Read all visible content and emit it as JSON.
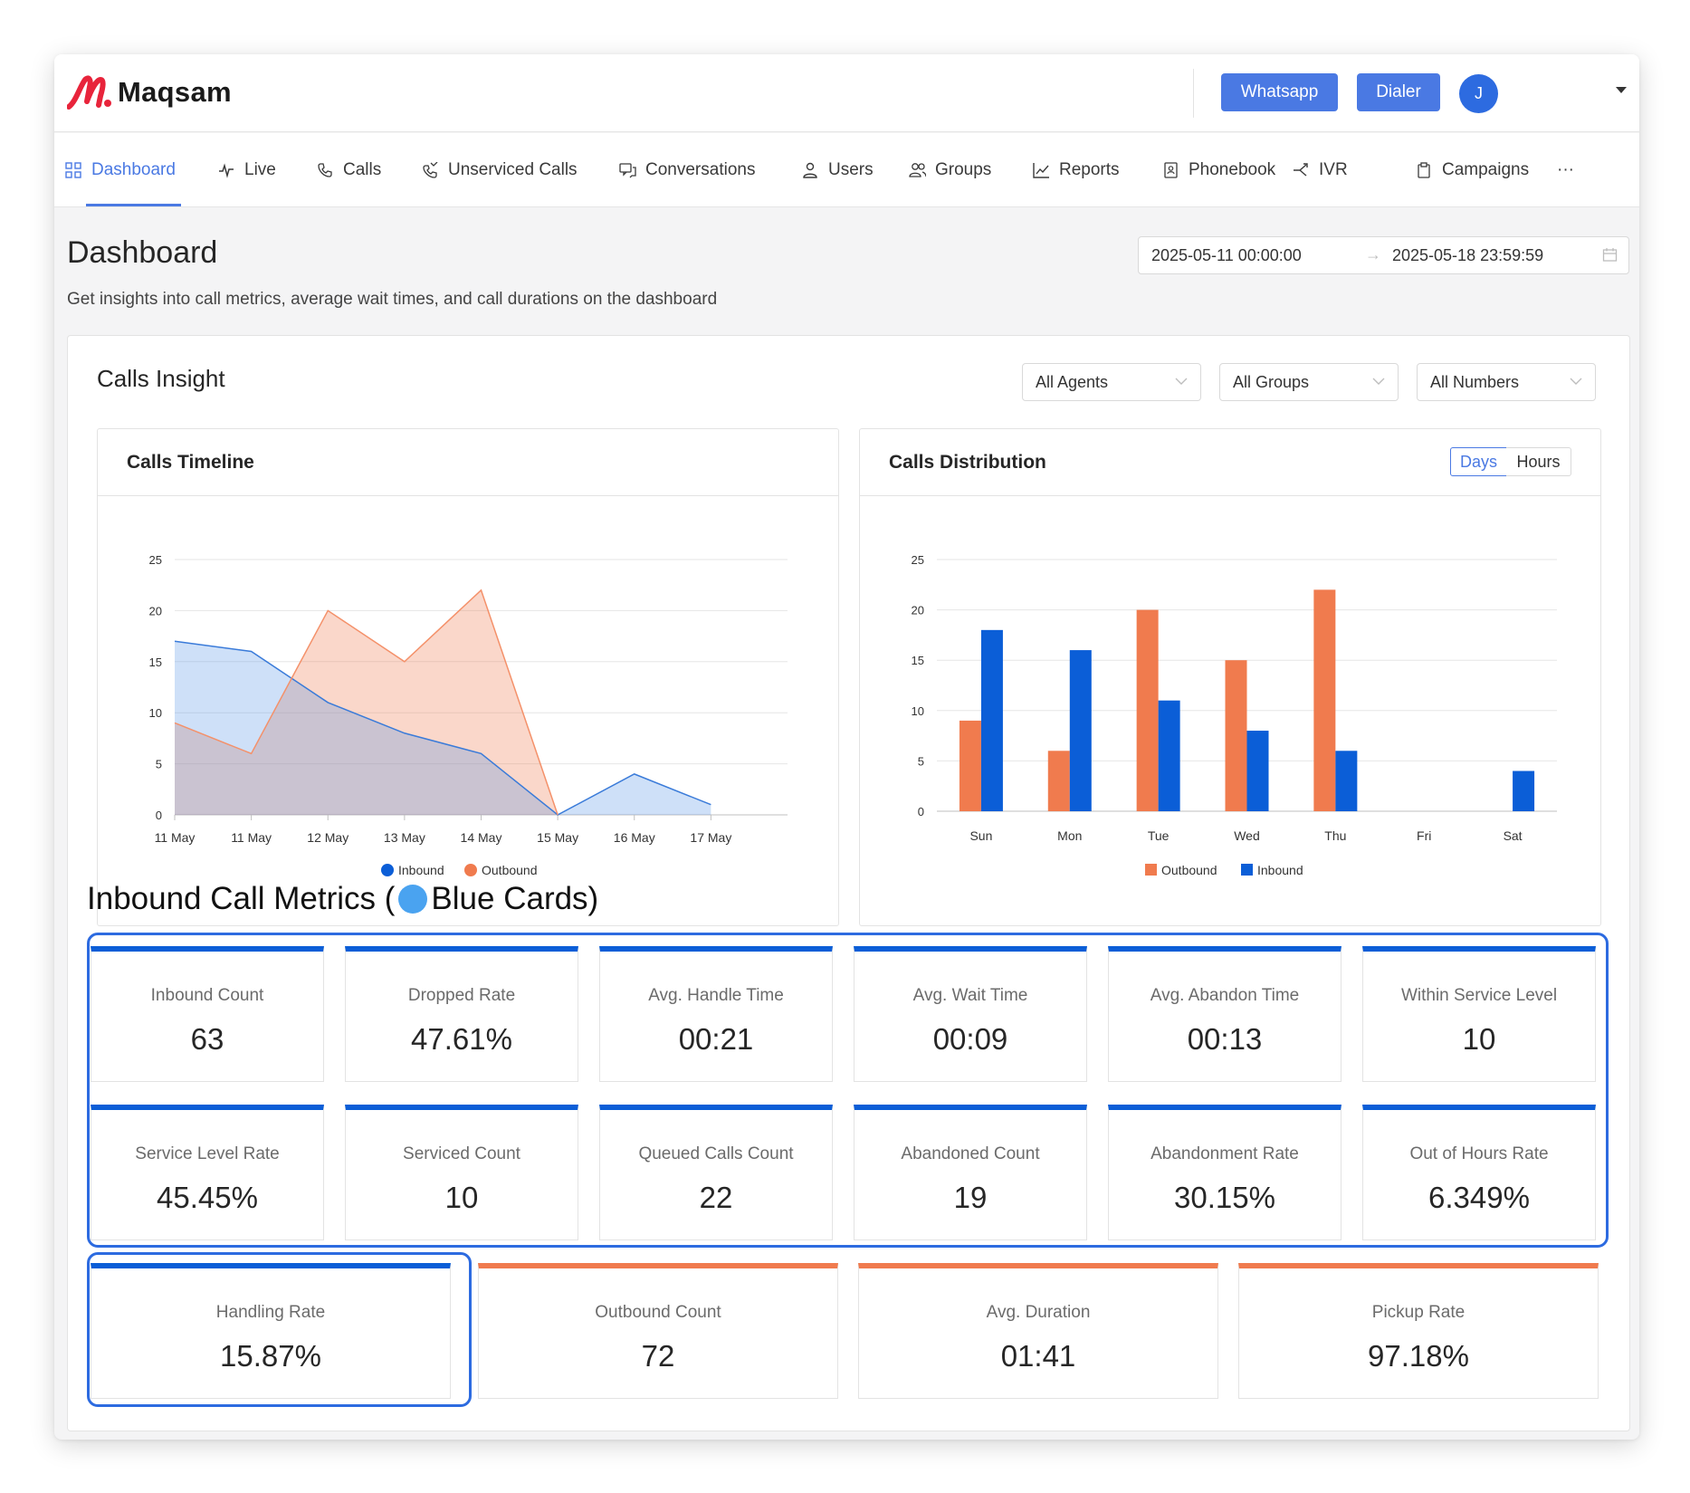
{
  "brand": {
    "name": "Maqsam"
  },
  "header": {
    "whatsapp_label": "Whatsapp",
    "dialer_label": "Dialer",
    "avatar_initial": "J"
  },
  "nav": [
    {
      "label": "Dashboard",
      "icon": "grid-icon",
      "active": true
    },
    {
      "label": "Live",
      "icon": "pulse-icon"
    },
    {
      "label": "Calls",
      "icon": "phone-icon"
    },
    {
      "label": "Unserviced Calls",
      "icon": "missed-call-icon"
    },
    {
      "label": "Conversations",
      "icon": "chat-icon"
    },
    {
      "label": "Users",
      "icon": "user-icon"
    },
    {
      "label": "Groups",
      "icon": "users-icon"
    },
    {
      "label": "Reports",
      "icon": "line-chart-icon"
    },
    {
      "label": "Phonebook",
      "icon": "contact-book-icon"
    },
    {
      "label": "IVR",
      "icon": "branch-icon"
    },
    {
      "label": "Campaigns",
      "icon": "clipboard-icon"
    },
    {
      "label": "···",
      "icon": "more-icon"
    }
  ],
  "page": {
    "title": "Dashboard",
    "subtitle": "Get insights into call metrics, average wait times, and call durations on the dashboard",
    "date_start": "2025-05-11 00:00:00",
    "date_end": "2025-05-18 23:59:59"
  },
  "insight": {
    "title": "Calls Insight",
    "filters": [
      "All Agents",
      "All Groups",
      "All Numbers"
    ]
  },
  "timeline": {
    "title": "Calls Timeline",
    "chart_data": {
      "type": "area",
      "x": [
        "11 May",
        "11 May",
        "12 May",
        "13 May",
        "14 May",
        "15 May",
        "16 May",
        "17 May"
      ],
      "ylim": [
        0,
        25
      ],
      "yticks": [
        0,
        5,
        10,
        15,
        20,
        25
      ],
      "grid": true,
      "legend_position": "bottom",
      "series": [
        {
          "name": "Inbound",
          "color": "#0b5ed7",
          "values": [
            17,
            16,
            11,
            8,
            6,
            0,
            4,
            1
          ]
        },
        {
          "name": "Outbound",
          "color": "#f07b4e",
          "values": [
            9,
            6,
            20,
            15,
            22,
            0,
            null,
            null
          ]
        }
      ]
    }
  },
  "distribution": {
    "title": "Calls Distribution",
    "toggle": [
      "Days",
      "Hours"
    ],
    "chart_data": {
      "type": "bar",
      "categories": [
        "Sun",
        "Mon",
        "Tue",
        "Wed",
        "Thu",
        "Fri",
        "Sat"
      ],
      "ylim": [
        0,
        25
      ],
      "yticks": [
        0,
        5,
        10,
        15,
        20,
        25
      ],
      "grid": true,
      "legend_position": "bottom",
      "series": [
        {
          "name": "Outbound",
          "color": "#f07b4e",
          "values": [
            9,
            6,
            20,
            15,
            22,
            0,
            0
          ]
        },
        {
          "name": "Inbound",
          "color": "#0b5ed7",
          "values": [
            18,
            16,
            11,
            8,
            6,
            0,
            4
          ]
        }
      ]
    }
  },
  "annotation": {
    "before": "Inbound Call Metrics (",
    "after": " Blue Cards)"
  },
  "inbound_metrics": [
    {
      "label": "Inbound Count",
      "value": "63"
    },
    {
      "label": "Dropped Rate",
      "value": "47.61%"
    },
    {
      "label": "Avg. Handle Time",
      "value": "00:21"
    },
    {
      "label": "Avg. Wait Time",
      "value": "00:09"
    },
    {
      "label": "Avg. Abandon Time",
      "value": "00:13"
    },
    {
      "label": "Within Service Level",
      "value": "10"
    },
    {
      "label": "Service Level Rate",
      "value": "45.45%"
    },
    {
      "label": "Serviced Count",
      "value": "10"
    },
    {
      "label": "Queued Calls Count",
      "value": "22"
    },
    {
      "label": "Abandoned Count",
      "value": "19"
    },
    {
      "label": "Abandonment Rate",
      "value": "30.15%"
    },
    {
      "label": "Out of Hours Rate",
      "value": "6.349%"
    },
    {
      "label": "Handling Rate",
      "value": "15.87%"
    }
  ],
  "outbound_metrics": [
    {
      "label": "Outbound Count",
      "value": "72"
    },
    {
      "label": "Avg. Duration",
      "value": "01:41"
    },
    {
      "label": "Pickup Rate",
      "value": "97.18%"
    }
  ],
  "colors": {
    "accent": "#4a79e3",
    "inbound": "#0b5ed7",
    "outbound": "#f07b4e",
    "highlight": "#2d6be0"
  }
}
